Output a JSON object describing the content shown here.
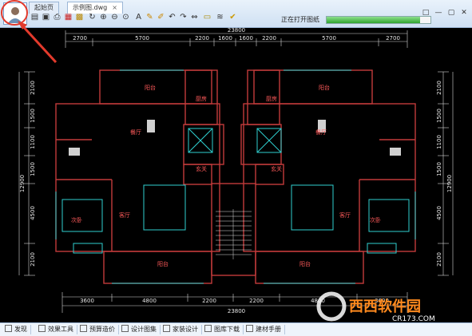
{
  "tabs": [
    {
      "label": "起始页"
    },
    {
      "label": "示例图.dwg",
      "close": "×"
    }
  ],
  "toolbar_icons": [
    "open-icon",
    "save-icon",
    "print-icon",
    "pdf-icon",
    "lock-icon",
    "rotate-icon",
    "zoom-in-icon",
    "zoom-out-icon",
    "zoom-window-icon",
    "text-icon",
    "pen-icon",
    "brush-icon",
    "undo-icon",
    "redo-icon",
    "measure-icon",
    "ruler-icon",
    "layers-icon",
    "check-icon"
  ],
  "status": {
    "text": "正在打开图纸",
    "progress_percent": 90
  },
  "window_buttons": [
    "□",
    "—",
    "▢",
    "✕"
  ],
  "dimensions": {
    "top_total": "23800",
    "top_parts": [
      "2700",
      "5700",
      "2200",
      "1600",
      "1600",
      "2200",
      "5700",
      "2700"
    ],
    "bottom_total": "23800",
    "bottom_parts": [
      "3600",
      "4800",
      "2200",
      "2200",
      "4800",
      "3600"
    ],
    "left": [
      "2100",
      "1500",
      "1100",
      "1500",
      "4500",
      "2100"
    ],
    "left_total": "12900",
    "right": [
      "2100",
      "1500",
      "1100",
      "1500",
      "4500",
      "2100"
    ],
    "right_total": "12900"
  },
  "rooms": {
    "balcony_top_left": "阳台",
    "balcony_top_right": "阳台",
    "kitchen_left": "厨房",
    "kitchen_right": "厨房",
    "dining_left": "餐厅",
    "dining_right": "餐厅",
    "foyer_left": "玄关",
    "foyer_right": "玄关",
    "bedroom_left": "次卧",
    "bedroom_right": "次卧",
    "living_left": "客厅",
    "living_right": "客厅",
    "balcony_bottom_left": "阳台",
    "balcony_bottom_right": "阳台"
  },
  "bottom_tabs": [
    "发现",
    "效果工具",
    "预算造价",
    "设计图集",
    "家装设计",
    "图库下载",
    "建材手册"
  ],
  "watermark": {
    "brand": "西西软件园",
    "site": "CR173.COM"
  },
  "colors": {
    "drawing_bg": "#000000",
    "wall": "#c23b3b",
    "dim": "#e8e8e8",
    "aux": "#2fd0d0",
    "room_text": "#ff5a5a",
    "arrow": "#e33a2c"
  }
}
